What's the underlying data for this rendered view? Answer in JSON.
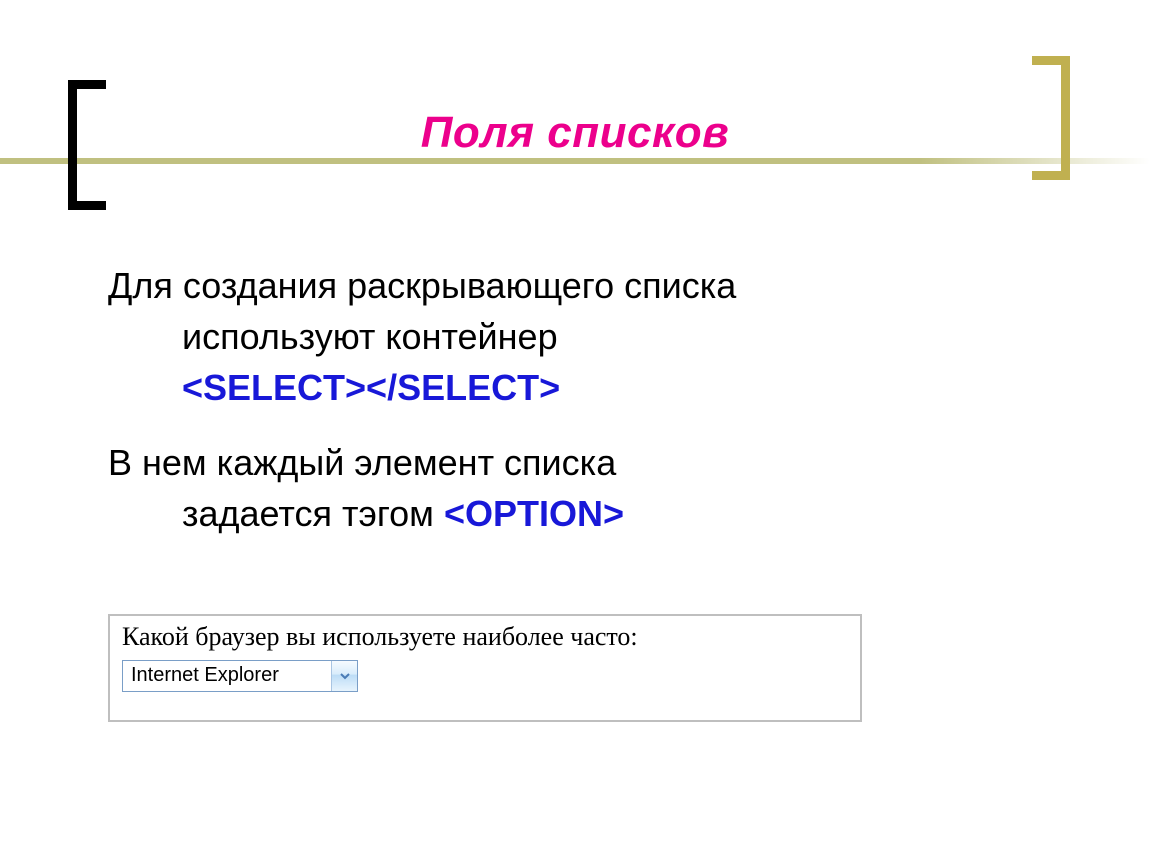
{
  "title": "Поля списков",
  "para1": {
    "line1": "Для создания раскрывающего списка",
    "line2_prefix": "используют контейнер",
    "code": "<SELECT></SELECT>"
  },
  "para2": {
    "line1": "В нем каждый элемент списка",
    "line2_prefix": "задается тэгом ",
    "code": "<OPTION>"
  },
  "example": {
    "label": "Какой браузер вы используете наиболее часто:",
    "selected_value": "Internet Explorer"
  }
}
